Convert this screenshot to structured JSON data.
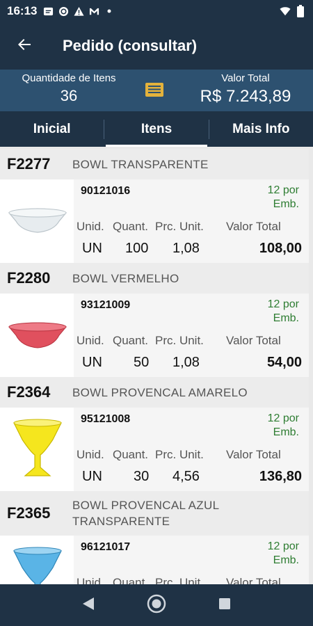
{
  "status_bar": {
    "time": "16:13"
  },
  "app_bar": {
    "title": "Pedido (consultar)"
  },
  "summary": {
    "qty_label": "Quantidade de Itens",
    "qty_value": "36",
    "total_label": "Valor Total",
    "total_value": "R$ 7.243,89"
  },
  "tabs": [
    {
      "label": "Inicial"
    },
    {
      "label": "Itens"
    },
    {
      "label": "Mais Info"
    }
  ],
  "column_labels": {
    "unid": "Unid.",
    "quant": "Quant.",
    "prc_unit": "Prc. Unit.",
    "valor_total": "Valor Total"
  },
  "items": [
    {
      "code": "F2277",
      "description": "BOWL TRANSPARENTE",
      "ref": "90121016",
      "emb": "12 por Emb.",
      "unid": "UN",
      "quant": "100",
      "prc_unit": "1,08",
      "total": "108,00",
      "color": "#dfe6ea"
    },
    {
      "code": "F2280",
      "description": "BOWL VERMELHO",
      "ref": "93121009",
      "emb": "12 por Emb.",
      "unid": "UN",
      "quant": "50",
      "prc_unit": "1,08",
      "total": "54,00",
      "color": "#e0505e"
    },
    {
      "code": "F2364",
      "description": "BOWL PROVENCAL AMARELO",
      "ref": "95121008",
      "emb": "12 por Emb.",
      "unid": "UN",
      "quant": "30",
      "prc_unit": "4,56",
      "total": "136,80",
      "color": "#f5e61e"
    },
    {
      "code": "F2365",
      "description": "BOWL PROVENCAL AZUL TRANSPARENTE",
      "ref": "96121017",
      "emb": "12 por Emb.",
      "unid": "UN",
      "quant": "",
      "prc_unit": "",
      "total": "",
      "color": "#5ab4e6"
    }
  ],
  "colors": {
    "primary": "#1f3245",
    "summary_bg": "#2d5170",
    "accent_icon": "#e3b23c",
    "emb_green": "#2e7d32"
  }
}
